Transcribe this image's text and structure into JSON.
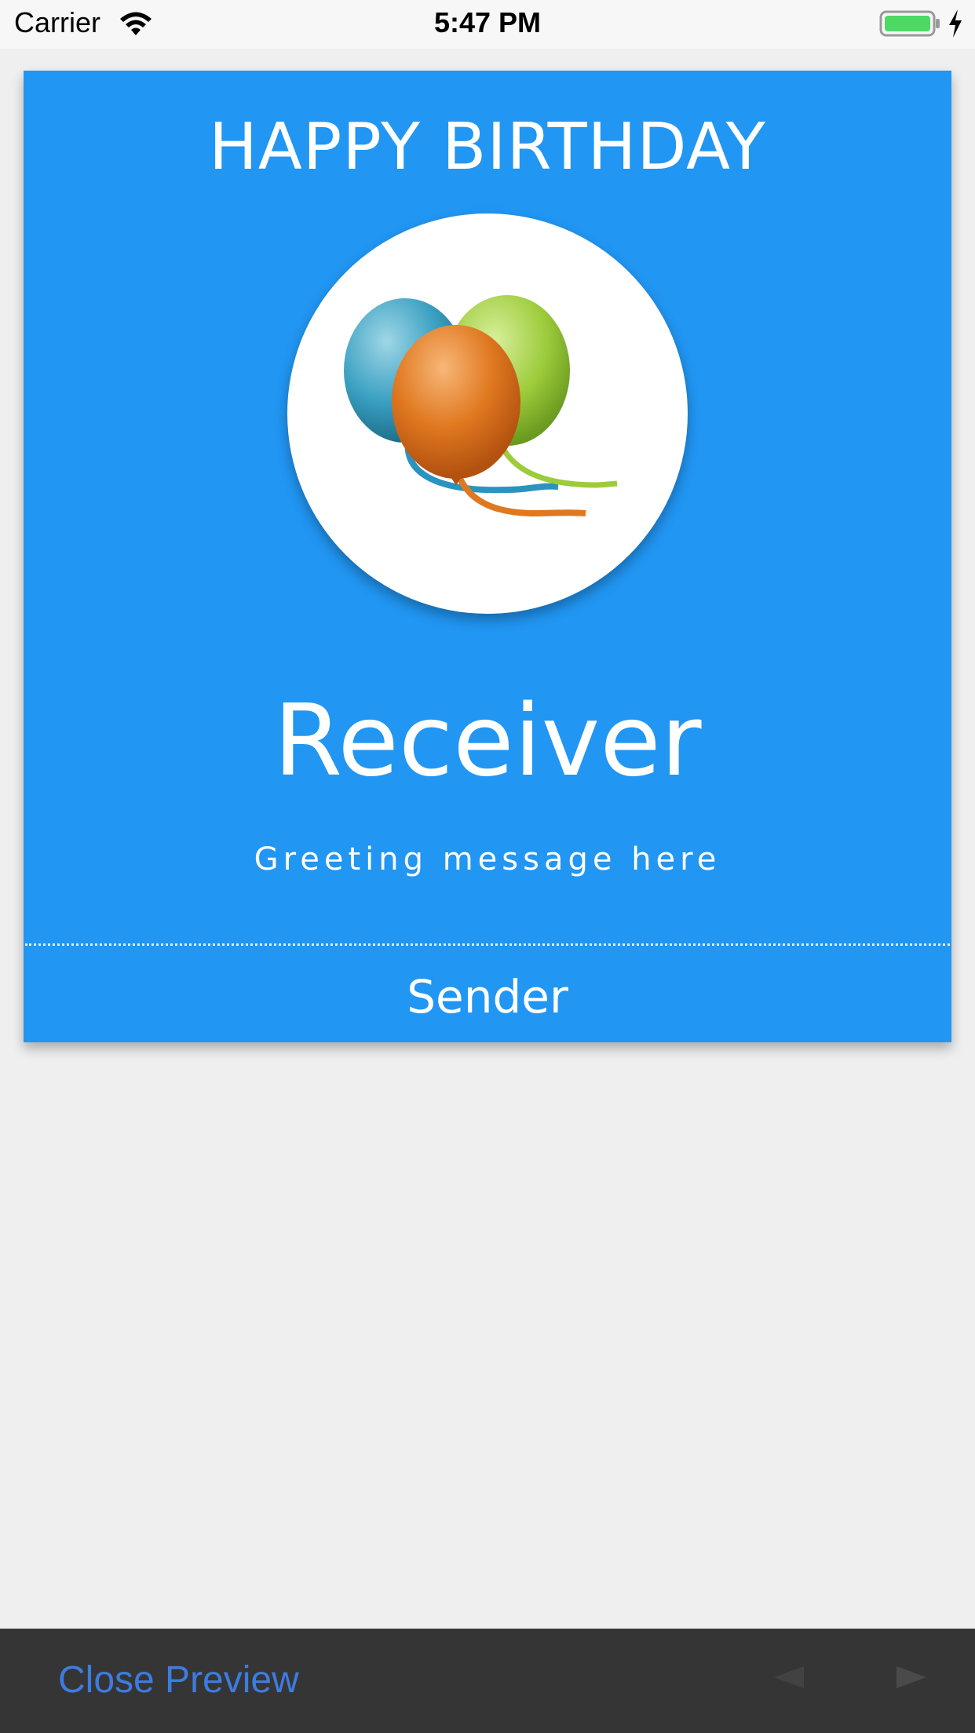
{
  "status_bar": {
    "carrier": "Carrier",
    "time": "5:47 PM",
    "battery_color": "#4cd964"
  },
  "card": {
    "title": "HAPPY BIRTHDAY",
    "receiver": "Receiver",
    "greeting": "Greeting message here",
    "sender": "Sender",
    "background_color": "#2196f3",
    "image_icon": "balloons-icon"
  },
  "toolbar": {
    "close_label": "Close Preview",
    "prev_icon": "triangle-left-icon",
    "next_icon": "triangle-right-icon",
    "accent_color": "#3d7ce0"
  }
}
